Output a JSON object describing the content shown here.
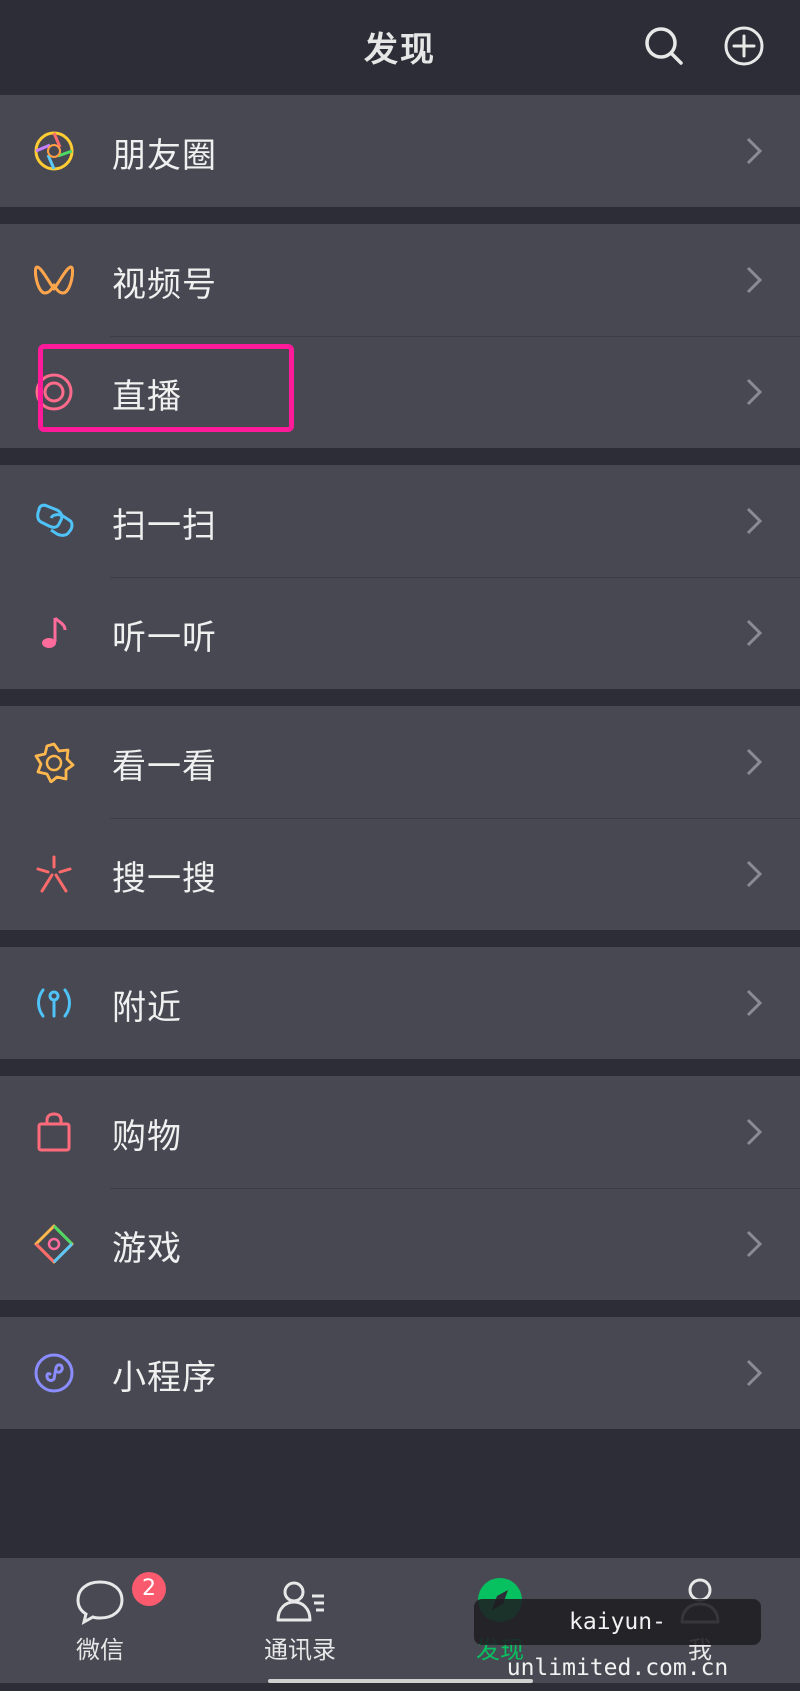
{
  "header": {
    "title": "发现"
  },
  "groups": [
    {
      "items": [
        {
          "label": "朋友圈",
          "icon": "moments-icon"
        }
      ]
    },
    {
      "items": [
        {
          "label": "视频号",
          "icon": "channels-icon"
        },
        {
          "label": "直播",
          "icon": "live-icon"
        }
      ]
    },
    {
      "items": [
        {
          "label": "扫一扫",
          "icon": "scan-icon"
        },
        {
          "label": "听一听",
          "icon": "music-note-icon"
        }
      ]
    },
    {
      "items": [
        {
          "label": "看一看",
          "icon": "top-stories-icon"
        },
        {
          "label": "搜一搜",
          "icon": "search-sparkle-icon"
        }
      ]
    },
    {
      "items": [
        {
          "label": "附近",
          "icon": "nearby-icon"
        }
      ]
    },
    {
      "items": [
        {
          "label": "购物",
          "icon": "shopping-bag-icon"
        },
        {
          "label": "游戏",
          "icon": "game-icon"
        }
      ]
    },
    {
      "items": [
        {
          "label": "小程序",
          "icon": "mini-program-icon"
        }
      ]
    }
  ],
  "tabs": [
    {
      "label": "微信",
      "badge": "2",
      "icon": "chat-bubble-icon"
    },
    {
      "label": "通讯录",
      "icon": "contacts-icon"
    },
    {
      "label": "发现",
      "icon": "discover-compass-icon",
      "active": true
    },
    {
      "label": "我",
      "icon": "me-person-icon"
    }
  ],
  "watermark": "kaiyun-unlimited.com.cn",
  "colors": {
    "accent": "#07c160",
    "highlight_box": "#ff1a9a",
    "badge": "#fa5a6e"
  }
}
